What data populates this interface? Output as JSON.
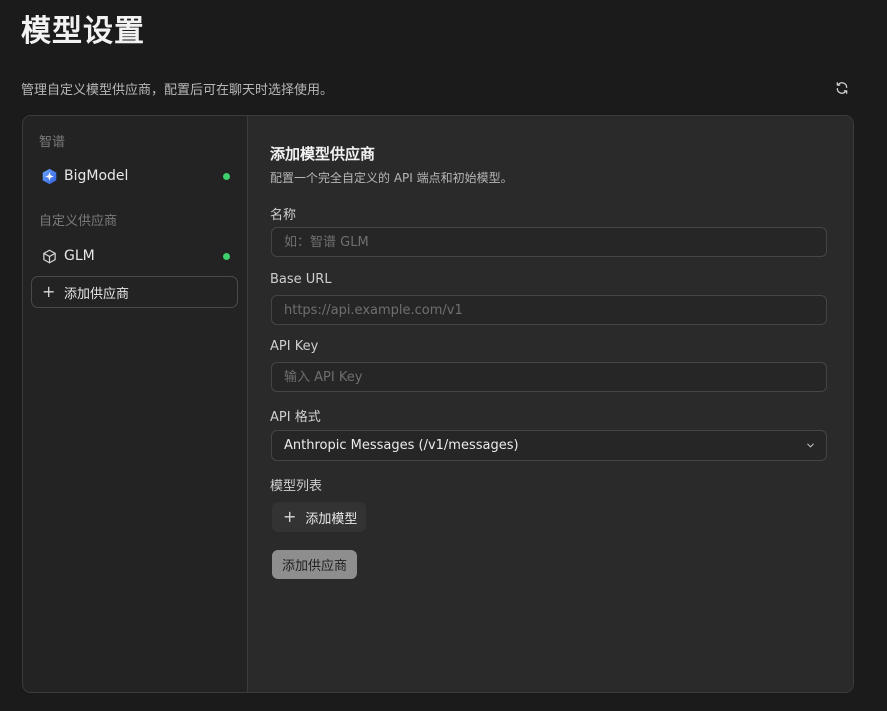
{
  "page": {
    "title": "模型设置",
    "subtitle": "管理自定义模型供应商，配置后可在聊天时选择使用。"
  },
  "icons": {
    "refresh": "refresh-icon",
    "bigmodel": "bigmodel-logo-icon",
    "custom_provider": "cube-icon",
    "add": "plus-icon",
    "dropdown": "chevron-down-icon"
  },
  "colors": {
    "status_online": "#3ecf6e",
    "submit_button": "#8e8e8e"
  },
  "sidebar": {
    "groups": [
      {
        "label": "智谱",
        "items": [
          {
            "label": "BigModel",
            "status": "online"
          }
        ]
      },
      {
        "label": "自定义供应商",
        "items": [
          {
            "label": "GLM",
            "status": "online"
          }
        ]
      }
    ],
    "add_provider_label": "添加供应商"
  },
  "form": {
    "title": "添加模型供应商",
    "description": "配置一个完全自定义的 API 端点和初始模型。",
    "name": {
      "label": "名称",
      "placeholder": "如：智谱 GLM",
      "value": ""
    },
    "base_url": {
      "label": "Base URL",
      "placeholder": "https://api.example.com/v1",
      "value": ""
    },
    "api_key": {
      "label": "API Key",
      "placeholder": "输入 API Key",
      "value": ""
    },
    "api_format": {
      "label": "API 格式",
      "selected": "Anthropic Messages (/v1/messages)"
    },
    "model_list": {
      "label": "模型列表",
      "add_model_label": "添加模型"
    },
    "submit_label": "添加供应商"
  }
}
